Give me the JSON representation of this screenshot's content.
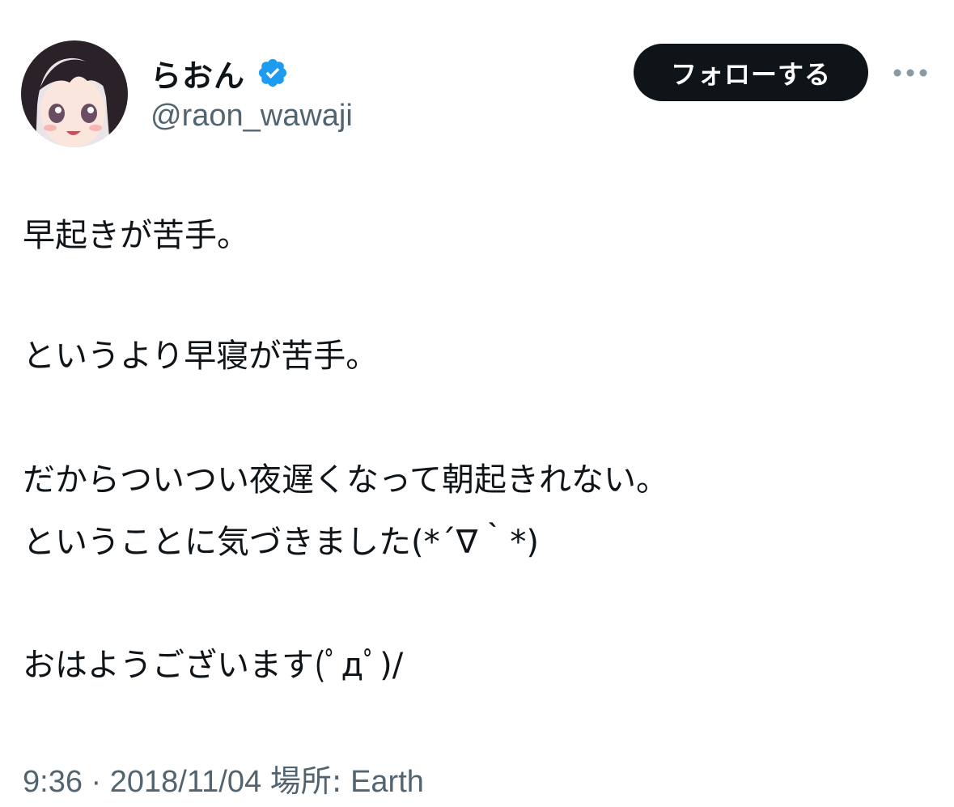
{
  "author": {
    "display_name": "らおん",
    "handle": "@raon_wawaji",
    "verified": true,
    "avatar_icon": "avatar-illustration"
  },
  "actions": {
    "follow_label": "フォローする",
    "more_icon": "more-horizontal-icon"
  },
  "tweet": {
    "lines": [
      "早起きが苦手。",
      "というより早寝が苦手。",
      "だからついつい夜遅くなって朝起きれない。",
      "ということに気づきました(*´∇｀*)",
      "おはようございます(ﾟдﾟ)/"
    ]
  },
  "meta": {
    "time": "9:36",
    "separator": " · ",
    "date": "2018/11/04",
    "location_label": "場所:",
    "location": "Earth"
  },
  "colors": {
    "text": "#0f1419",
    "secondary": "#536471",
    "verified": "#1d9bf0",
    "button_bg": "#0f1419",
    "button_text": "#ffffff"
  }
}
